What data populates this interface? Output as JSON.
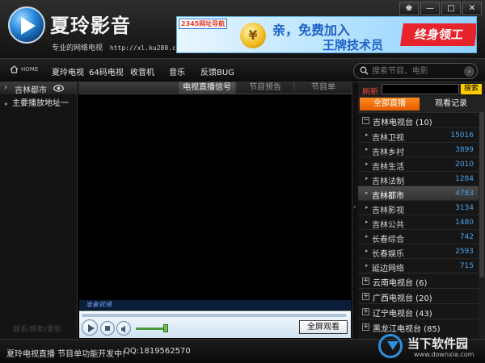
{
  "app": {
    "name": "夏玲影音",
    "slogan": "专业的网络电视",
    "url": "http://xl.ku280.com"
  },
  "window_controls": [
    "♚",
    "—",
    "□",
    "✕"
  ],
  "ad": {
    "tag": "2345网址导航",
    "coin": "¥",
    "line1": "亲，免费加入",
    "line2": "王牌技术员",
    "highlight": "终身领工"
  },
  "nav": {
    "home": "HOME",
    "items": [
      "夏玲电视",
      "64码电视",
      "收音机",
      "音乐",
      "反馈BUG"
    ],
    "search_placeholder": "搜索节目、电影",
    "search_go": "›"
  },
  "left": {
    "header_label": "吉林都市",
    "items": [
      "主要播放地址一"
    ],
    "footer": "联系/帮助/更新"
  },
  "center": {
    "tabs": [
      "电视直播信号",
      "节目预告",
      "节目单"
    ],
    "status": "准备就绪",
    "fullscreen": "全屏观看",
    "progress": 0,
    "volume": 0.85
  },
  "right": {
    "refresh": "刷新",
    "search_btn": "搜索",
    "tabs": [
      "全部直播",
      "观看记录"
    ],
    "group_title": "吉林电视台 (10)",
    "channels": [
      {
        "name": "吉林卫视",
        "count": "15016"
      },
      {
        "name": "吉林乡村",
        "count": "3899"
      },
      {
        "name": "吉林生活",
        "count": "2010"
      },
      {
        "name": "吉林法制",
        "count": "1284"
      },
      {
        "name": "吉林都市",
        "count": "4783"
      },
      {
        "name": "吉林影视",
        "count": "3134"
      },
      {
        "name": "吉林公共",
        "count": "1480"
      },
      {
        "name": "长春综合",
        "count": "742"
      },
      {
        "name": "长春娱乐",
        "count": "2593"
      },
      {
        "name": "延边网络",
        "count": "715"
      }
    ],
    "selected_index": 4,
    "other_groups": [
      "云南电视台 (6)",
      "广西电视台 (20)",
      "辽宁电视台 (43)",
      "黑龙江电视台 (85)"
    ]
  },
  "statusbar": {
    "message": "夏玲电视直播 节目单功能开发中!",
    "qq": "QQ:1819562570"
  },
  "watermark": {
    "text": "当下软件园",
    "url": "www.downxia.com"
  },
  "colors": {
    "accent_orange": "#e55a00",
    "count_blue": "#4ea1e6",
    "refresh_red": "#e84a3c",
    "search_yellow": "#ffcc00"
  }
}
